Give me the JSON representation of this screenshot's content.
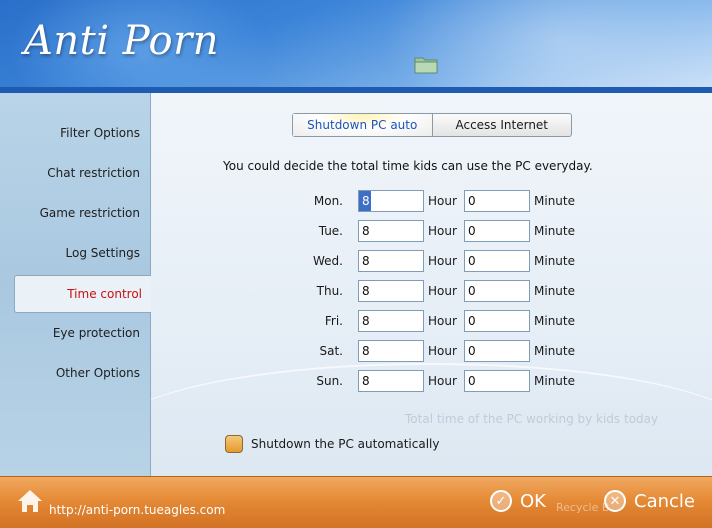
{
  "app": {
    "title": "Anti Porn"
  },
  "sidebar": {
    "items": [
      {
        "label": "Filter Options"
      },
      {
        "label": "Chat restriction"
      },
      {
        "label": "Game restriction"
      },
      {
        "label": "Log Settings"
      },
      {
        "label": "Time control"
      },
      {
        "label": "Eye protection"
      },
      {
        "label": "Other Options"
      }
    ],
    "active": "Time control"
  },
  "tabs": [
    {
      "label": "Shutdown PC auto"
    },
    {
      "label": "Access Internet"
    }
  ],
  "main": {
    "description": "You could decide the total time kids can use the PC everyday.",
    "hour_unit": "Hour",
    "minute_unit": "Minute",
    "days": [
      {
        "label": "Mon.",
        "hour": "8",
        "minute": "0"
      },
      {
        "label": "Tue.",
        "hour": "8",
        "minute": "0"
      },
      {
        "label": "Wed.",
        "hour": "8",
        "minute": "0"
      },
      {
        "label": "Thu.",
        "hour": "8",
        "minute": "0"
      },
      {
        "label": "Fri.",
        "hour": "8",
        "minute": "0"
      },
      {
        "label": "Sat.",
        "hour": "8",
        "minute": "0"
      },
      {
        "label": "Sun.",
        "hour": "8",
        "minute": "0"
      }
    ],
    "total_label": "Total time of the PC working by kids today",
    "auto_shutdown_label": "Shutdown the PC automatically"
  },
  "footer": {
    "url": "http://anti-porn.tueagles.com",
    "ok_label": "OK",
    "cancel_label": "Cancle",
    "ghost_text": "Recycle B"
  },
  "colors": {
    "header_blue": "#2a6fc9",
    "footer_orange": "#e58a36",
    "active_red": "#c81010",
    "tab_blue": "#1a55b8"
  }
}
